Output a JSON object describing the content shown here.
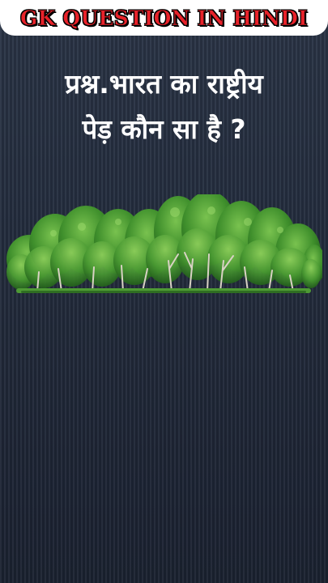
{
  "header": {
    "title": "GK QUESTION IN HINDI"
  },
  "question": {
    "line1": "प्रश्न.भारत का राष्ट्रीय",
    "line2": "पेड़ कौन सा है ?"
  },
  "colors": {
    "header_background": "#ffffff",
    "title_text": "#e8222a",
    "page_background": "#222b3c",
    "question_text": "#ffffff",
    "foliage": "#3e8f2c"
  },
  "illustration": {
    "icon": "trees-grove-illustration"
  }
}
